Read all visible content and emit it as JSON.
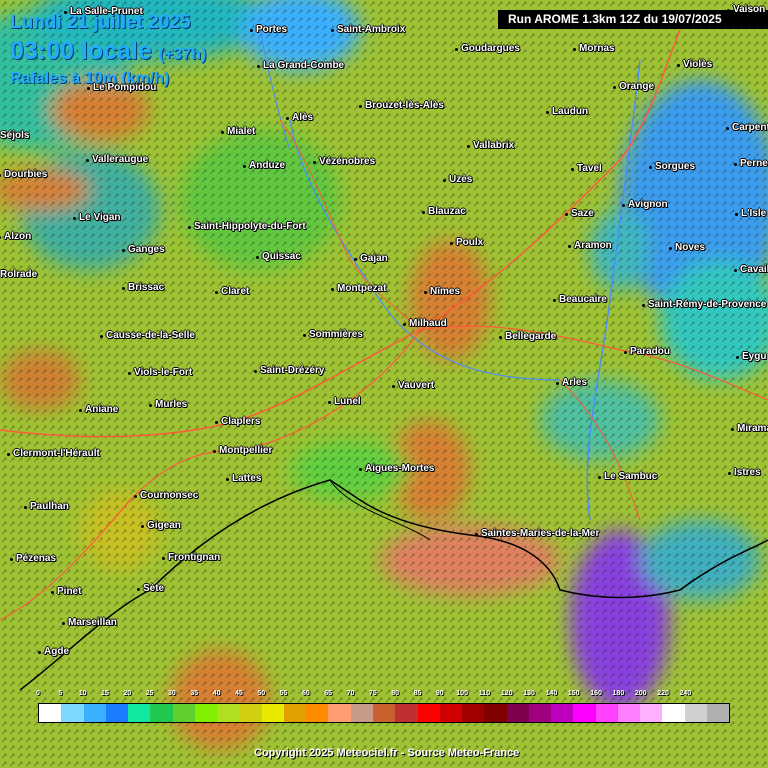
{
  "header": {
    "date": "Lundi 21 juillet 2025",
    "time_local": "03:00 locale",
    "lead_time": "(+37h)",
    "variable": "Rafales à 10m (km/h)",
    "run": "Run AROME 1.3km 12Z du 19/07/2025"
  },
  "cities": [
    "La Salle-Prunet",
    "Portes",
    "Saint-Ambroix",
    "Goudargues",
    "Mornas",
    "Violès",
    "Le Pompidou",
    "La Grand-Combe",
    "Orange",
    "Brouzet-lès-Alès",
    "Alès",
    "Laudun",
    "Mialet",
    "Vallabrix",
    "Carpentras",
    "Sorgues",
    "Tavel",
    "Pernes",
    "Valleraugue",
    "Anduze",
    "Vézénobres",
    "Uzès",
    "Dourbies",
    "Avignon",
    "Saze",
    "L'Isle",
    "Blauzac",
    "Le Vigan",
    "Saint-Hippolyte-du-Fort",
    "Aramon",
    "Alzon",
    "Ganges",
    "Poulx",
    "Noves",
    "Quissac",
    "Gajan",
    "Cavail",
    "Brissac",
    "Claret",
    "Montpezat",
    "Nîmes",
    "Beaucaire",
    "Saint-Rémy-de-Provence",
    "Milhaud",
    "Causse-de-la-Selle",
    "Sommières",
    "Bellegarde",
    "Paradou",
    "Eygu",
    "Viols-le-Fort",
    "Saint-Drézéry",
    "Arles",
    "Vauvert",
    "Lunel",
    "Aniane",
    "Murles",
    "Claplers",
    "Miramas",
    "Clermont-l'Hérault",
    "Montpellier",
    "Aigues-Mortes",
    "Lattes",
    "Istres",
    "Le Sambuc",
    "Cournonsec",
    "Paulhan",
    "Gigean",
    "Saintes-Maries-de-la-Mer",
    "Pézenas",
    "Frontignan",
    "Sète",
    "Pinet",
    "Marseillan",
    "Agde",
    "Vaison",
    "Mornas",
    "Rolrade",
    "Séjols"
  ],
  "legend": {
    "ticks": [
      "0",
      "5",
      "10",
      "15",
      "20",
      "25",
      "30",
      "35",
      "40",
      "45",
      "50",
      "55",
      "60",
      "65",
      "70",
      "75",
      "80",
      "85",
      "90",
      "100",
      "110",
      "120",
      "130",
      "140",
      "150",
      "160",
      "180",
      "200",
      "220",
      "240"
    ],
    "colors": [
      "#ffffff",
      "#7fd8ff",
      "#3ab0ff",
      "#1a7cff",
      "#10e8a0",
      "#20c850",
      "#60d030",
      "#80f000",
      "#b0e020",
      "#d0d010",
      "#e8e800",
      "#e0a000",
      "#ff8c00",
      "#ff9c70",
      "#c89a8a",
      "#c86030",
      "#c03030",
      "#ff0000",
      "#d00000",
      "#a00000",
      "#800000",
      "#800050",
      "#a00080",
      "#c000c0",
      "#ff00ff",
      "#ff40ff",
      "#ff80ff",
      "#ffb0ff",
      "#ffffff",
      "#d0d0d0",
      "#b0b0b0"
    ]
  },
  "copyright": "Copyright 2025 Meteociel.fr - Source Meteo-France"
}
